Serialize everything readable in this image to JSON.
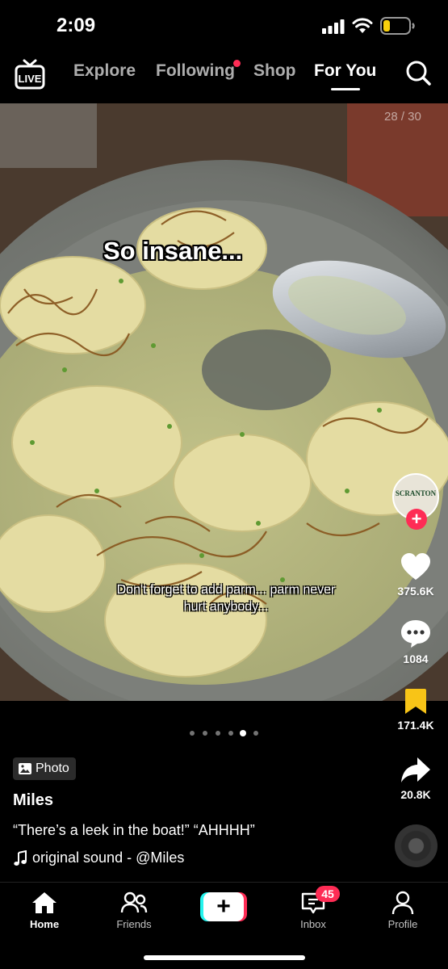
{
  "status_bar": {
    "time": "2:09"
  },
  "top_nav": {
    "live_label": "LIVE",
    "tabs": [
      {
        "label": "Explore",
        "active": false
      },
      {
        "label": "Following",
        "active": false,
        "has_notification_dot": true
      },
      {
        "label": "Shop",
        "active": false
      },
      {
        "label": "For You",
        "active": true
      }
    ]
  },
  "post": {
    "page_counter": "28 / 30",
    "overlay_caption": "So insane...",
    "overlay_subcaption": "Don't forget to add parm... parm never hurt anybody...",
    "photo_badge": "Photo",
    "username": "Miles",
    "description": "“There’s a leek in the boat!” “AHHHH”",
    "sound": "original sound - @Miles",
    "carousel": {
      "total_dots": 6,
      "active_index": 4
    }
  },
  "actions": {
    "avatar_text": "SCRANTON",
    "likes": "375.6K",
    "comments": "1084",
    "saves": "171.4K",
    "shares": "20.8K"
  },
  "bottom_nav": {
    "home": "Home",
    "friends": "Friends",
    "create": "+",
    "inbox": "Inbox",
    "inbox_badge": "45",
    "profile": "Profile"
  },
  "colors": {
    "accent": "#fe2c55",
    "cyan": "#25f4ee",
    "save_yellow": "#f8c417"
  }
}
